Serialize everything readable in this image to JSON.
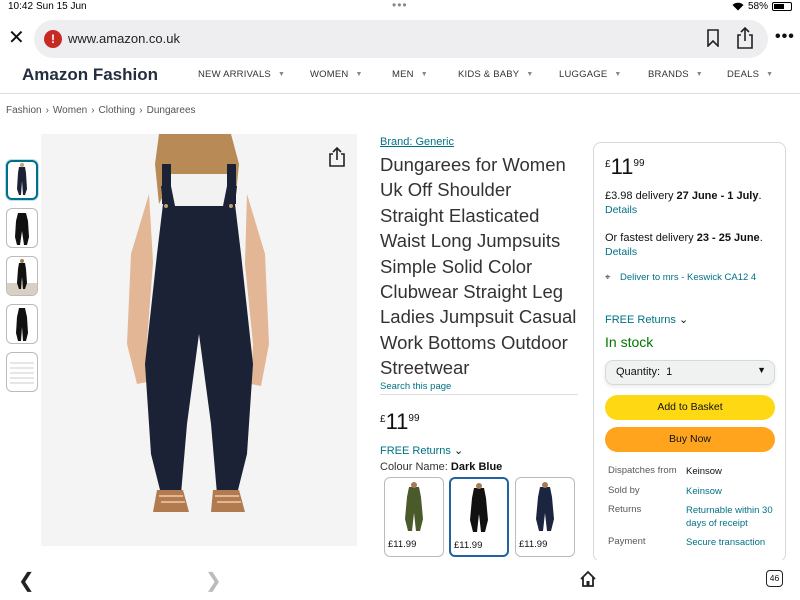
{
  "status_bar": {
    "time": "10:42",
    "date": "Sun 15 Jun",
    "battery": "58%"
  },
  "browser": {
    "url": "www.amazon.co.uk",
    "tab_count": "46"
  },
  "nav": {
    "brand": "Amazon Fashion",
    "items": [
      "NEW ARRIVALS",
      "WOMEN",
      "MEN",
      "KIDS & BABY",
      "LUGGAGE",
      "BRANDS",
      "DEALS"
    ]
  },
  "breadcrumb": [
    "Fashion",
    "Women",
    "Clothing",
    "Dungarees"
  ],
  "product": {
    "brand_link": "Brand: Generic",
    "title": "Dungarees for Women Uk Off Shoulder Straight Elasticated Waist Long Jumpsuits Simple Solid Color Clubwear Straight Leg Ladies Jumpsuit Casual Work Bottoms Outdoor Streetwear",
    "search_page": "Search this page",
    "price": {
      "currency": "£",
      "whole": "11",
      "fraction": "99"
    },
    "free_returns": "FREE Returns",
    "colour_label": "Colour Name:",
    "colour_value": "Dark Blue",
    "swatches": [
      {
        "price": "£11.99",
        "color": "#4b5a2a"
      },
      {
        "price": "£11.99",
        "color": "#111111"
      },
      {
        "price": "£11.99",
        "color": "#1c2540"
      }
    ],
    "garment_color": "#1b2236"
  },
  "buy_box": {
    "price": {
      "currency": "£",
      "whole": "11",
      "fraction": "99"
    },
    "delivery_prefix": "£3.98 delivery ",
    "delivery_dates": "27 June - 1 July",
    "delivery_suffix": ".",
    "details_1": "Details",
    "fastest_prefix": "Or fastest delivery ",
    "fastest_dates": "23 - 25 June",
    "fastest_suffix": ".",
    "details_2": "Details",
    "deliver_to": "Deliver to mrs - Keswick CA12 4",
    "free_returns": "FREE Returns",
    "in_stock": "In stock",
    "quantity_label": "Quantity:",
    "quantity_value": "1",
    "add_to_basket": "Add to Basket",
    "buy_now": "Buy Now",
    "info": [
      {
        "label": "Dispatches from",
        "value": "Keinsow"
      },
      {
        "label": "Sold by",
        "value": "Keinsow"
      },
      {
        "label": "Returns",
        "value": "Returnable within 30 days of receipt"
      },
      {
        "label": "Payment",
        "value": "Secure transaction"
      }
    ]
  },
  "colors": {
    "link": "#007185",
    "cart_button": "#ffd814",
    "buy_button": "#ffa41c",
    "in_stock": "#007600"
  }
}
